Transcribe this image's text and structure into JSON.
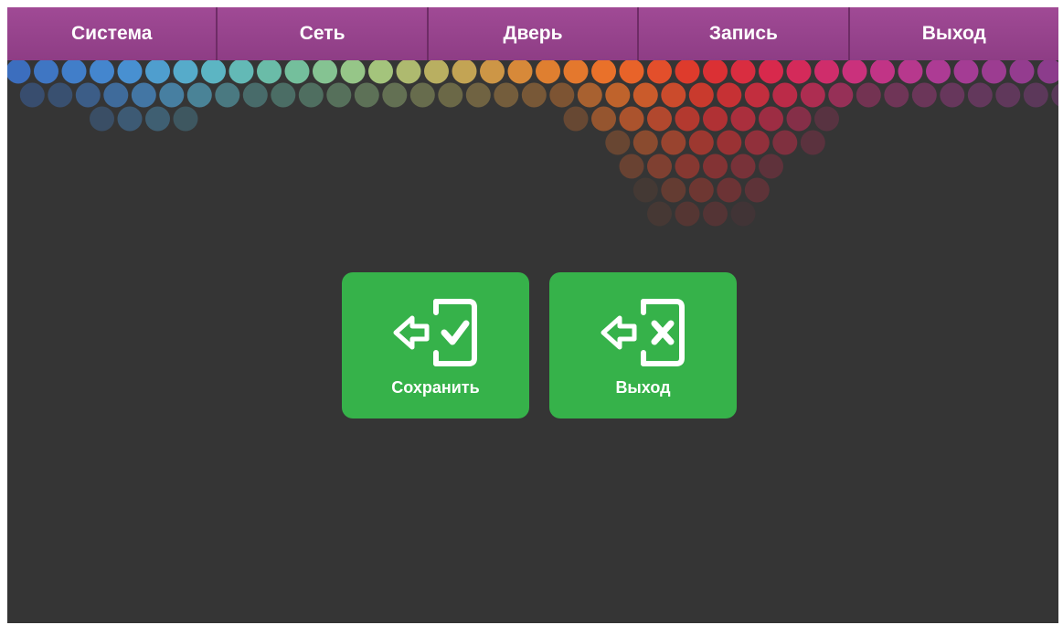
{
  "tabs": [
    {
      "label": "Система"
    },
    {
      "label": "Сеть"
    },
    {
      "label": "Дверь"
    },
    {
      "label": "Запись"
    },
    {
      "label": "Выход"
    }
  ],
  "actions": {
    "save_label": "Сохранить",
    "exit_label": "Выход",
    "save_icon": "exit-with-check-icon",
    "exit_icon": "exit-with-cross-icon"
  },
  "colors": {
    "tabbar": "#9b4592",
    "background": "#353535",
    "button": "#36b24a",
    "text": "#ffffff"
  }
}
